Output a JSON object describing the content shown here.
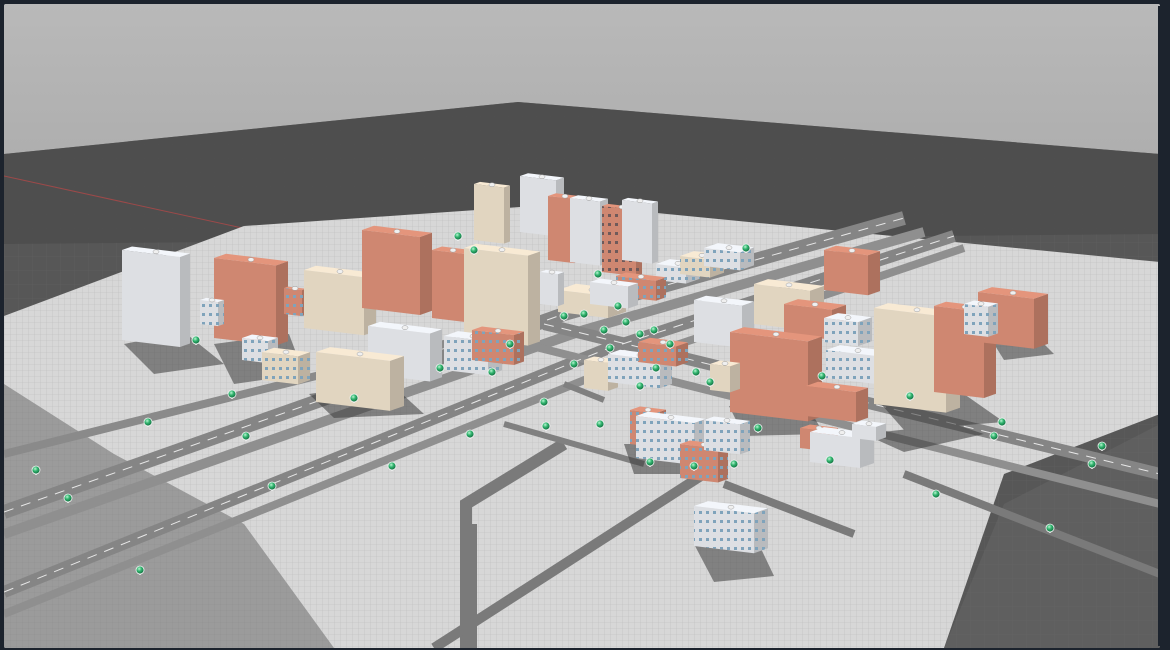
{
  "app": {
    "title": "",
    "view": "3d-city-viewport"
  },
  "scene": {
    "colors": {
      "sky": "#b5b5b5",
      "ground_far": "#4a4a4a",
      "ground_near": "#5b5b5b",
      "city_tile": "#d4d4d4",
      "road": "#7d7d7d",
      "building_terracotta": "#d38a73",
      "building_beige": "#e6d9c4",
      "building_white": "#e1e4e8",
      "marker": "#2fae69",
      "window": "#7fa3bb"
    },
    "icons": [
      "green-marker-icon"
    ],
    "building_count": 34,
    "marker_count": 48
  }
}
